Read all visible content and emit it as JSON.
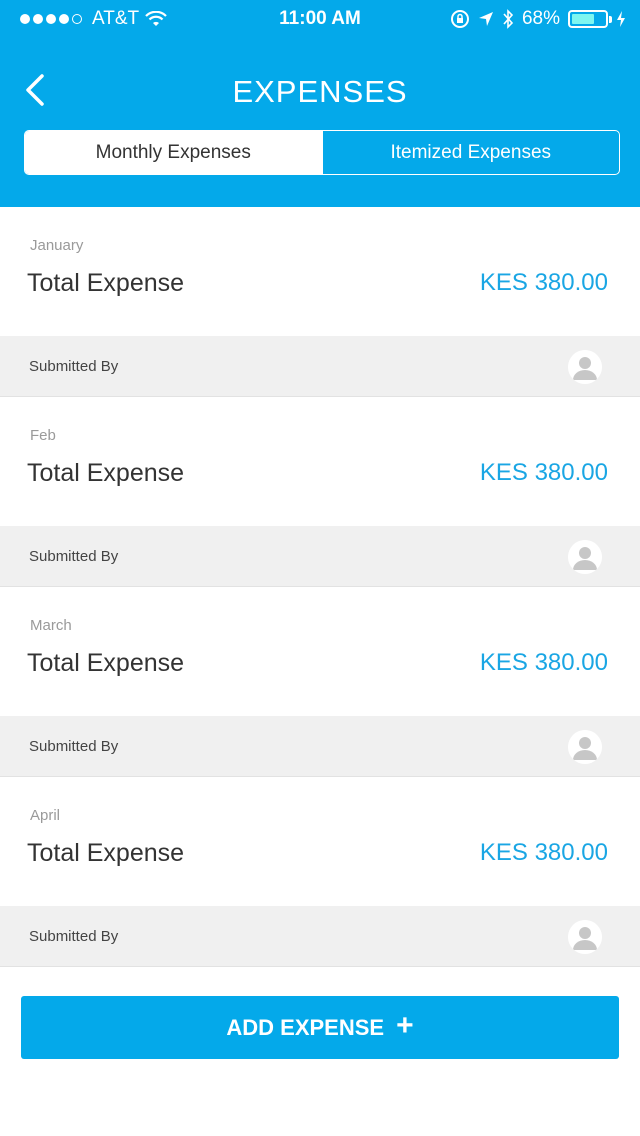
{
  "status_bar": {
    "carrier": "AT&T",
    "time": "11:00 AM",
    "battery": "68%",
    "battery_level": 0.68,
    "signal_bars_filled": 4,
    "signal_bars_total": 5
  },
  "header": {
    "title": "EXPENSES",
    "back_icon": "chevron-left-icon",
    "tabs": [
      {
        "label": "Monthly Expenses",
        "active": true
      },
      {
        "label": "Itemized Expenses",
        "active": false
      }
    ]
  },
  "expenses": [
    {
      "month": "January",
      "label": "Total Expense",
      "amount": "KES 380.00",
      "submitted_label": "Submitted By"
    },
    {
      "month": "Feb",
      "label": "Total Expense",
      "amount": "KES 380.00",
      "submitted_label": "Submitted By"
    },
    {
      "month": "March",
      "label": "Total Expense",
      "amount": "KES 380.00",
      "submitted_label": "Submitted By"
    },
    {
      "month": "April",
      "label": "Total Expense",
      "amount": "KES 380.00",
      "submitted_label": "Submitted By"
    }
  ],
  "add_button": {
    "label": "ADD EXPENSE",
    "icon": "+"
  },
  "colors": {
    "accent": "#04a9ea",
    "amount": "#1aa6e4",
    "row_bg": "#f0f0f0"
  }
}
